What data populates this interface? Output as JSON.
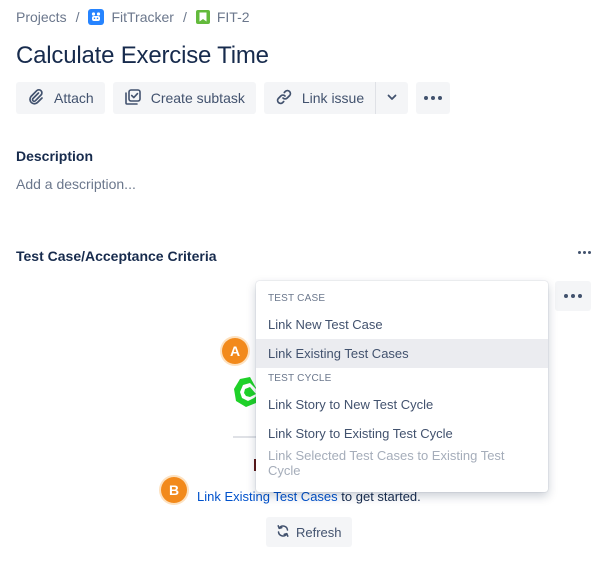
{
  "breadcrumb": {
    "projects": "Projects",
    "separator": "/",
    "project_name": "FitTracker",
    "issue_key": "FIT-2"
  },
  "issue": {
    "title": "Calculate Exercise Time"
  },
  "toolbar": {
    "attach": "Attach",
    "create_subtask": "Create subtask",
    "link_issue": "Link issue"
  },
  "description": {
    "heading": "Description",
    "placeholder": "Add a description..."
  },
  "test_case_panel": {
    "heading": "Test Case/Acceptance Criteria",
    "empty_link": "Link Existing Test Cases",
    "empty_suffix": " to get started.",
    "refresh": "Refresh"
  },
  "dropdown": {
    "group_test_case": "TEST CASE",
    "link_new_test_case": "Link New Test Case",
    "link_existing_test_cases": "Link Existing Test Cases",
    "group_test_cycle": "TEST CYCLE",
    "link_story_new_cycle": "Link Story to New Test Cycle",
    "link_story_existing_cycle": "Link Story to Existing Test Cycle",
    "link_selected_existing_cycle": "Link Selected Test Cases to Existing Test Cycle"
  },
  "annotations": {
    "a": "A",
    "b": "B"
  },
  "colors": {
    "link": "#0052cc",
    "badge": "#f28a1c",
    "project_icon": "#2684ff",
    "issue_icon": "#63ba3c",
    "illustration_green": "#36b37e"
  },
  "icons": {
    "project": "fittracker-project-icon",
    "issue": "story-bookmark-icon",
    "attach": "paperclip-icon",
    "subtask": "checkbox-subtask-icon",
    "link": "chain-link-icon",
    "dropdown": "chevron-down-icon",
    "more": "more-horizontal-icon",
    "refresh": "refresh-icon"
  }
}
